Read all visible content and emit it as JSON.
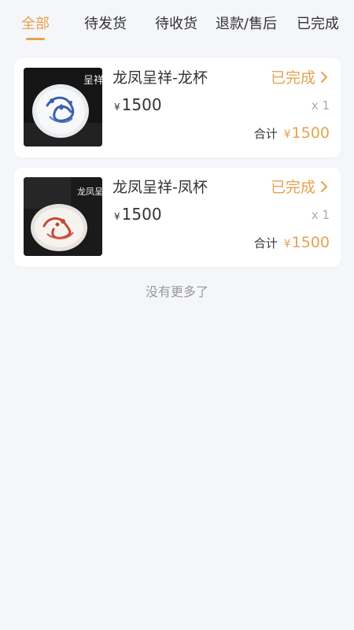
{
  "tabs": [
    {
      "label": "全部",
      "active": true
    },
    {
      "label": "待发货",
      "active": false
    },
    {
      "label": "待收货",
      "active": false
    },
    {
      "label": "退款/售后",
      "active": false
    },
    {
      "label": "已完成",
      "active": false
    }
  ],
  "orders": [
    {
      "name": "龙凤呈祥-龙杯",
      "status": "已完成",
      "currency": "¥",
      "price": "1500",
      "quantity": "x 1",
      "total_label": "合计",
      "total": "1500",
      "image_caption": "呈祥",
      "image_icon": "dragon-plate-image"
    },
    {
      "name": "龙凤呈祥-凤杯",
      "status": "已完成",
      "currency": "¥",
      "price": "1500",
      "quantity": "x 1",
      "total_label": "合计",
      "total": "1500",
      "image_caption": "龙凤呈祥",
      "image_icon": "phoenix-plate-image"
    }
  ],
  "footer": {
    "no_more": "没有更多了"
  },
  "colors": {
    "accent": "#e7a24f",
    "background": "#f5f6fa",
    "card": "#ffffff"
  }
}
